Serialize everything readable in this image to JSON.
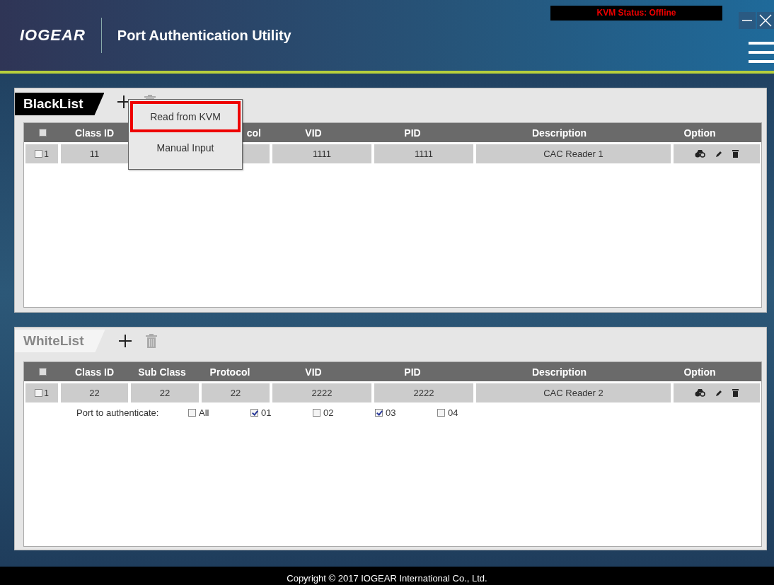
{
  "window": {
    "logo": "IOGEAR",
    "title": "Port Authentication Utility",
    "status": "KVM Status: Offline"
  },
  "lists": [
    {
      "title": "BlackList",
      "selected": true,
      "all_checked": false,
      "columns": [
        {
          "label": "Class ID"
        },
        {
          "label": "col"
        },
        {
          "label": "VID"
        },
        {
          "label": "PID"
        },
        {
          "label": "Description"
        },
        {
          "label": "Option"
        }
      ],
      "rows": [
        {
          "number": "1",
          "checked": false,
          "cells": [
            {
              "value": "11"
            },
            {},
            {
              "value": "1111"
            },
            {
              "value": "1111"
            },
            {
              "value": "CAC Reader 1"
            }
          ]
        }
      ],
      "add_menu": {
        "items": [
          {
            "label": "Read from KVM",
            "selected": true
          },
          {
            "label": "Manual Input",
            "selected": false
          }
        ]
      }
    },
    {
      "title": "WhiteList",
      "selected": false,
      "all_checked": false,
      "columns": [
        {
          "label": "Class ID"
        },
        {
          "label": "Sub Class"
        },
        {
          "label": "Protocol"
        },
        {
          "label": "VID"
        },
        {
          "label": "PID"
        },
        {
          "label": "Description"
        },
        {
          "label": "Option"
        }
      ],
      "rows": [
        {
          "number": "1",
          "checked": false,
          "cells": [
            {
              "value": "22"
            },
            {
              "value": "22"
            },
            {
              "value": "22"
            },
            {
              "value": "2222"
            },
            {
              "value": "2222"
            },
            {
              "value": "CAC Reader 2"
            }
          ],
          "ports": {
            "label": "Port to authenticate:",
            "options": [
              {
                "label": "All",
                "checked": false
              },
              {
                "label": "01",
                "checked": true
              },
              {
                "label": "02",
                "checked": false
              },
              {
                "label": "03",
                "checked": true
              },
              {
                "label": "04",
                "checked": false
              }
            ]
          }
        }
      ]
    }
  ],
  "footer": "Copyright © 2017 IOGEAR International Co., Ltd."
}
